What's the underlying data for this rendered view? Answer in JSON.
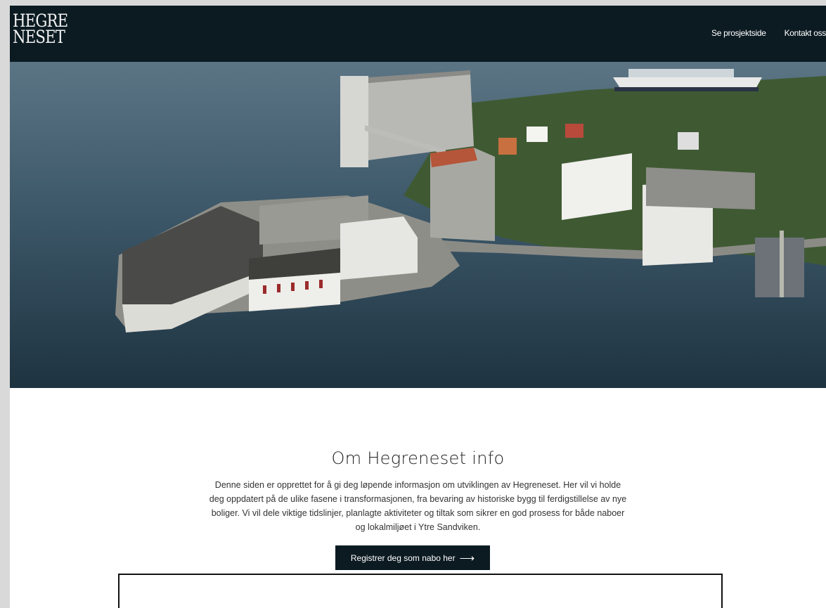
{
  "header": {
    "logo_line1": "HEGRE",
    "logo_line2": "NESET",
    "nav": [
      {
        "label": "Se prosjektside"
      },
      {
        "label": "Kontakt oss"
      }
    ]
  },
  "main": {
    "title": "Om Hegreneset info",
    "description": "Denne siden er opprettet for å gi deg løpende informasjon om utviklingen av Hegreneset. Her vil vi holde deg oppdatert på de ulike fasene i transformasjonen, fra bevaring av historiske bygg til ferdigstillelse av nye boliger. Vi vil dele viktige tidslinjer, planlagte aktiviteter og tiltak som sikrer en god prosess for både naboer og lokalmiljøet i Ytre Sandviken.",
    "cta_label": "Registrer deg som nabo her",
    "cta_icon": "arrow-right-icon"
  },
  "colors": {
    "header_bg": "#0c1b22",
    "button_bg": "#0c1b22",
    "water": "#3a5566"
  }
}
